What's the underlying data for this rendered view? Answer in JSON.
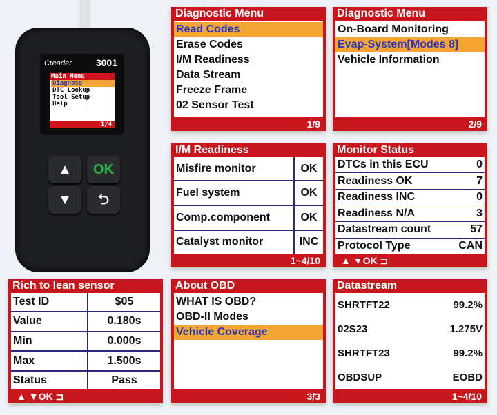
{
  "device": {
    "brand": "Creader",
    "model": "3001",
    "screen_title": "Main Menu",
    "items": [
      "Diagnose",
      "DTC Lookup",
      "Tool Setup",
      "Help"
    ],
    "selected": 0,
    "page": "1/4",
    "buttons": {
      "up": "▲",
      "ok": "OK",
      "down": "▼",
      "back": "⮌"
    }
  },
  "diag1": {
    "title": "Diagnostic Menu",
    "items": [
      "Read Codes",
      "Erase Codes",
      "I/M Readiness",
      "Data Stream",
      "Freeze Frame",
      "02 Sensor Test"
    ],
    "selected": 0,
    "page": "1/9"
  },
  "diag2": {
    "title": "Diagnostic Menu",
    "items": [
      "On-Board Monitoring",
      "Evap-System[Modes 8]",
      "Vehicle Information"
    ],
    "selected": 1,
    "page": "2/9"
  },
  "im": {
    "title": "I/M Readiness",
    "rows": [
      [
        "Misfire monitor",
        "OK"
      ],
      [
        "Fuel system",
        "OK"
      ],
      [
        "Comp.component",
        "OK"
      ],
      [
        "Catalyst monitor",
        "INC"
      ]
    ],
    "page": "1~4/10"
  },
  "monitor": {
    "title": "Monitor Status",
    "rows": [
      [
        "DTCs in this ECU",
        "0"
      ],
      [
        "Readiness OK",
        "7"
      ],
      [
        "Readiness INC",
        "0"
      ],
      [
        "Readiness  N/A",
        "3"
      ],
      [
        "Datastream count",
        "57"
      ],
      [
        "Protocol Type",
        "CAN"
      ]
    ],
    "footer": "▲ ▼OK ⊐"
  },
  "sensor": {
    "title": "Rich to lean sensor",
    "rows": [
      [
        "Test ID",
        "$05"
      ],
      [
        "Value",
        "0.180s"
      ],
      [
        "Min",
        "0.000s"
      ],
      [
        "Max",
        "1.500s"
      ],
      [
        "Status",
        "Pass"
      ]
    ],
    "footer": "▲ ▼OK ⊐"
  },
  "about": {
    "title": "About OBD",
    "items": [
      "WHAT IS OBD?",
      "OBD-II Modes",
      "Vehicle Coverage"
    ],
    "selected": 2,
    "page": "3/3"
  },
  "datastream": {
    "title": "Datastream",
    "rows": [
      [
        "SHRTFT22",
        "99.2%"
      ],
      [
        "02S23",
        "1.275V"
      ],
      [
        "SHRTFT23",
        "99.2%"
      ],
      [
        "OBDSUP",
        "EOBD"
      ]
    ],
    "page": "1~4/10"
  },
  "colors": {
    "panel_red": "#c9161c",
    "highlight": "#f5a531",
    "highlight_text": "#2a35c4",
    "ok_green": "#2bb34a"
  }
}
